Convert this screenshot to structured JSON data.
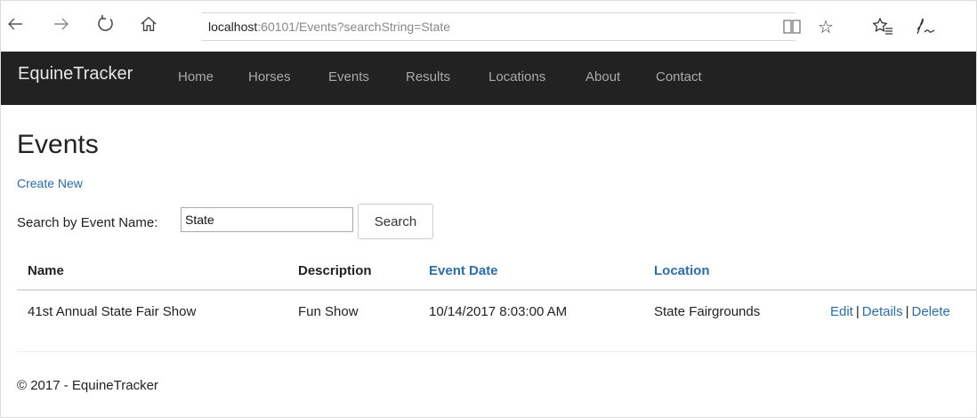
{
  "browser": {
    "url_host": "localhost",
    "url_rest": ":60101/Events?searchString=State",
    "icons": {
      "back": "back-arrow-icon",
      "forward": "forward-arrow-icon",
      "refresh": "refresh-icon",
      "home": "home-icon",
      "reading_view": "reading-view-icon",
      "favorite": "star-icon",
      "favorites_hub": "favorites-list-icon",
      "notes": "pen-icon"
    }
  },
  "navbar": {
    "brand": "EquineTracker",
    "links": [
      "Home",
      "Horses",
      "Events",
      "Results",
      "Locations",
      "About",
      "Contact"
    ]
  },
  "page": {
    "title": "Events",
    "create_new": "Create New",
    "search": {
      "label": "Search by Event Name:",
      "value": "State",
      "button": "Search"
    },
    "table": {
      "headers": [
        "Name",
        "Description",
        "Event Date",
        "Location"
      ],
      "rows": [
        {
          "name": "41st Annual State Fair Show",
          "description": "Fun Show",
          "event_date": "10/14/2017 8:03:00 AM",
          "location": "State Fairgrounds",
          "actions": [
            "Edit",
            "Details",
            "Delete"
          ]
        }
      ]
    },
    "footer": "© 2017 - EquineTracker"
  },
  "colors": {
    "navbar_bg": "#222222",
    "link": "#2a6ead"
  }
}
